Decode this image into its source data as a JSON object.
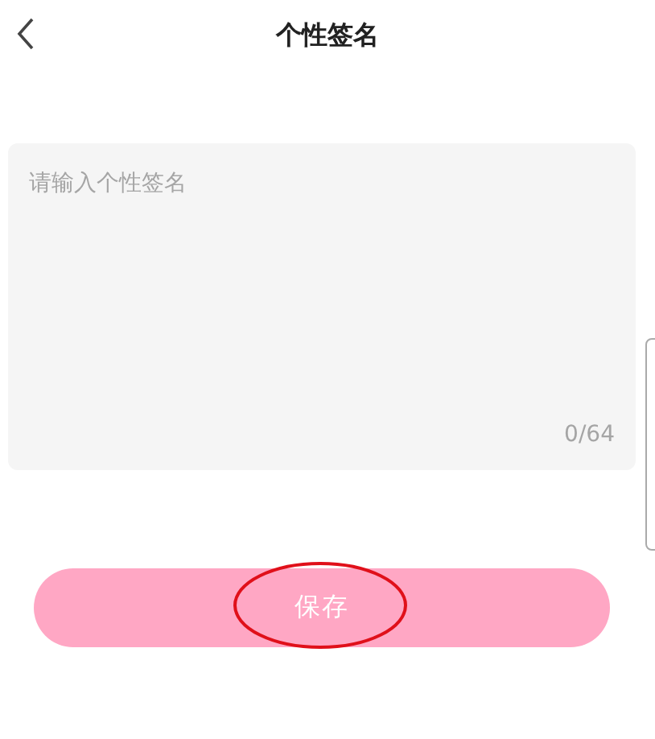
{
  "header": {
    "title": "个性签名"
  },
  "signature": {
    "placeholder": "请输入个性签名",
    "counter": "0/64"
  },
  "save_button": {
    "label": "保存"
  }
}
